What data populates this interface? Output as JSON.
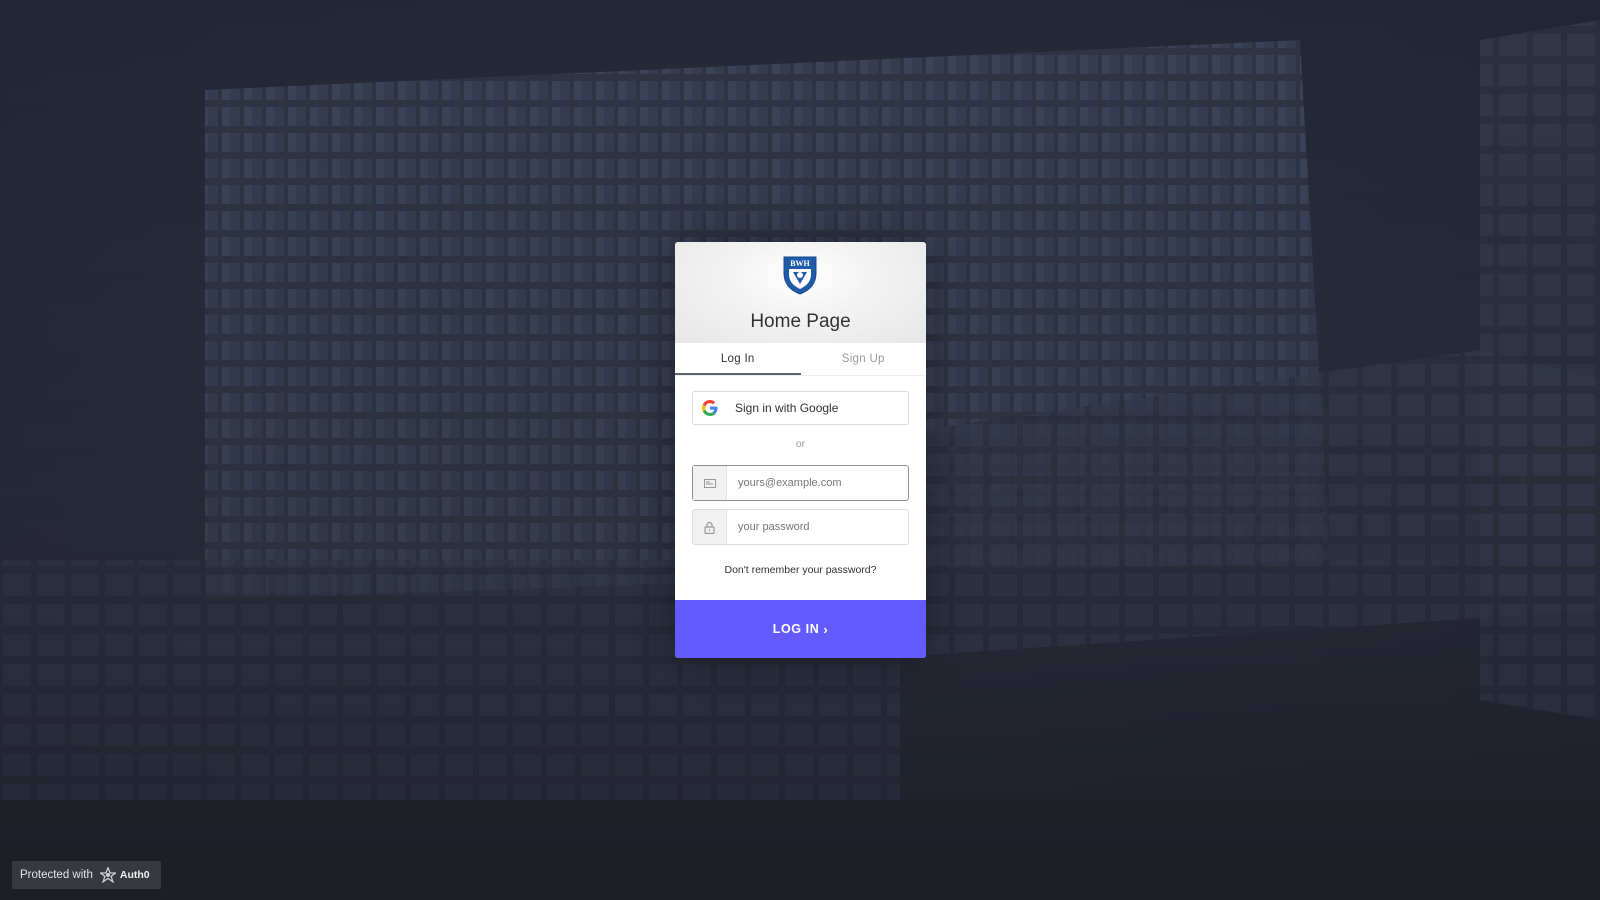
{
  "header": {
    "logo_text": "BWH",
    "title": "Home Page"
  },
  "tabs": [
    {
      "label": "Log In",
      "active": true
    },
    {
      "label": "Sign Up",
      "active": false
    }
  ],
  "social": {
    "google_label": "Sign in with Google"
  },
  "separator": "or",
  "form": {
    "email_placeholder": "yours@example.com",
    "password_placeholder": "your password",
    "forgot_link": "Don't remember your password?",
    "submit_label": "LOG IN",
    "submit_icon": "chevron-right-icon"
  },
  "footer_badge": {
    "prefix": "Protected with",
    "brand": "Auth0"
  },
  "colors": {
    "accent": "#635bff",
    "logo_blue": "#1f5ba8"
  }
}
